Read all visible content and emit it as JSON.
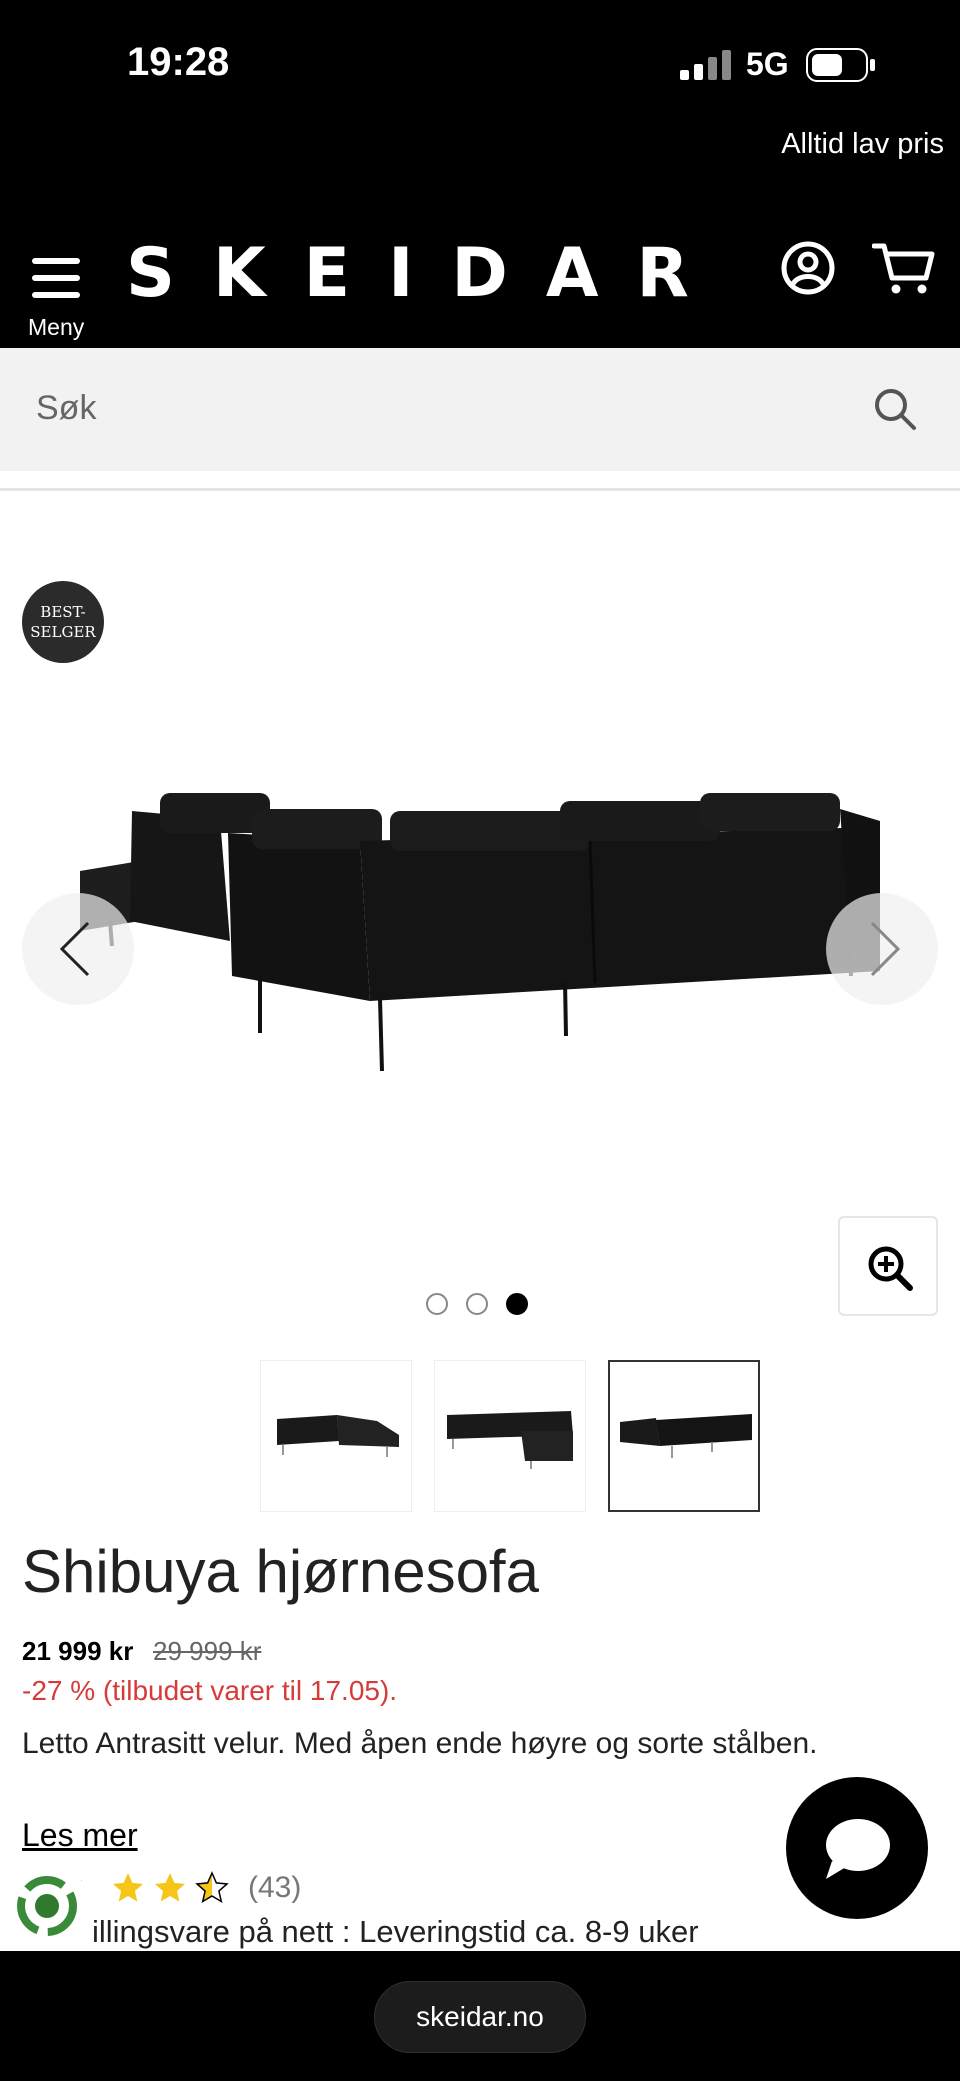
{
  "status_bar": {
    "time": "19:28",
    "network": "5G"
  },
  "header": {
    "promo_text": "Alltid lav pris",
    "menu_label": "Meny",
    "logo": "SKEIDAR"
  },
  "search": {
    "placeholder": "Søk"
  },
  "product": {
    "badge_line1": "BEST-",
    "badge_line2": "SELGER",
    "title": "Shibuya hjørnesofa",
    "price_current": "21 999 kr",
    "price_original": "29 999 kr",
    "discount_text": "-27 % (tilbudet varer til 17.05).",
    "description": "Letto Antrasitt velur. Med åpen ende høyre og sorte stålben.",
    "read_more": "Les mer",
    "rating": 2.5,
    "review_count": "(43)",
    "delivery_text": "illingsvare på nett : Leveringstid ca. 8-9 uker",
    "carousel": {
      "total_slides": 3,
      "active_slide": 3
    },
    "thumbnails": [
      "sofa-view-front",
      "sofa-view-angle",
      "sofa-view-back"
    ]
  },
  "browser": {
    "url": "skeidar.no"
  },
  "colors": {
    "background": "#000000",
    "discount": "#d83a3a",
    "star": "#f5c518"
  }
}
